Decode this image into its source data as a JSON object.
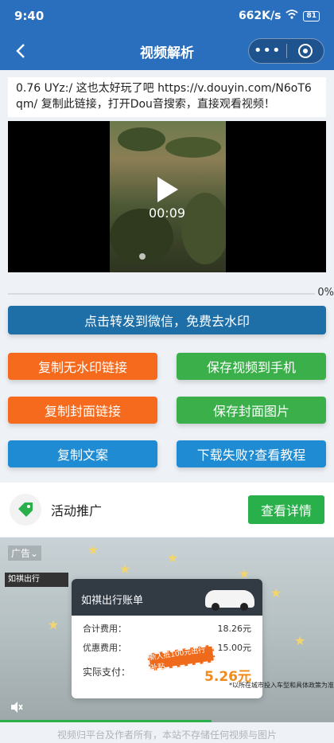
{
  "status_bar": {
    "time": "9:40",
    "speed": "662K/s",
    "battery": "81"
  },
  "nav": {
    "title": "视频解析",
    "back_icon": "chevron-left-icon",
    "more_glyph": "•••"
  },
  "share_text": "0.76 UYz:/ 这也太好玩了吧  https://v.douyin.com/N6oT6qm/ 复制此链接，打开Dou音搜索，直接观看视频！",
  "video": {
    "duration": "00:09"
  },
  "progress": {
    "percent": 0,
    "label": "0%"
  },
  "buttons": {
    "share": "点击转发到微信，免费去水印",
    "copy_link": "复制无水印链接",
    "save_video": "保存视频到手机",
    "copy_cover": "复制封面链接",
    "save_cover": "保存封面图片",
    "copy_text": "复制文案",
    "help": "下载失败?查看教程"
  },
  "colors": {
    "nav": "#2a6fbd",
    "orange": "#f56a1c",
    "green": "#3bb04a",
    "blue": "#1e8bd2",
    "share": "#1e6fa8"
  },
  "promo": {
    "label": "活动推广",
    "detail": "查看详情"
  },
  "ad": {
    "tag": "广告⌄",
    "brand": "如祺出行",
    "card_title": "如祺出行账单",
    "rows": [
      {
        "k": "合计费用：",
        "v": "18.26元"
      },
      {
        "k": "优惠费用：",
        "v": "15.00元"
      }
    ],
    "total_label": "实际支付：",
    "total_value": "5.26元",
    "stamp": "新人抵100元出行补贴",
    "note": "*以所在城市投入车型和具体政策为准"
  },
  "footer": "视频归平台及作者所有，本站不存储任何视频与图片"
}
